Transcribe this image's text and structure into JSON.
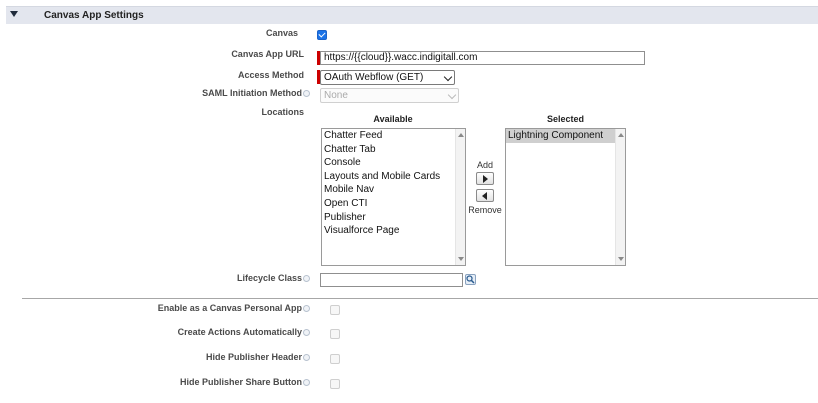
{
  "section": {
    "title": "Canvas App Settings",
    "toggle_icon": "collapse-triangle-icon"
  },
  "fields": {
    "canvas": {
      "label": "Canvas",
      "checked": true
    },
    "canvas_app_url": {
      "label": "Canvas App URL",
      "value": "https://{{cloud}}.wacc.indigitall.com",
      "required": true
    },
    "access_method": {
      "label": "Access Method",
      "value": "OAuth Webflow (GET)",
      "required": true
    },
    "saml_initiation_method": {
      "label": "SAML Initiation Method",
      "value": "None",
      "disabled": true,
      "help_icon": "info-icon"
    },
    "locations": {
      "label": "Locations",
      "available_title": "Available",
      "selected_title": "Selected",
      "available": [
        "Chatter Feed",
        "Chatter Tab",
        "Console",
        "Layouts and Mobile Cards",
        "Mobile Nav",
        "Open CTI",
        "Publisher",
        "Visualforce Page"
      ],
      "selected": [
        "Lightning Component"
      ],
      "add_label": "Add",
      "remove_label": "Remove"
    },
    "lifecycle_class": {
      "label": "Lifecycle Class",
      "value": "",
      "help_icon": "info-icon",
      "lookup_icon": "lookup-icon"
    }
  },
  "options": [
    {
      "label": "Enable as a Canvas Personal App",
      "checked": false
    },
    {
      "label": "Create Actions Automatically",
      "checked": false
    },
    {
      "label": "Hide Publisher Header",
      "checked": false
    },
    {
      "label": "Hide Publisher Share Button",
      "checked": false
    }
  ],
  "colors": {
    "header_bg": "#e3e6ee",
    "required": "#cc0000",
    "checkbox_checked": "#1a73e8"
  }
}
